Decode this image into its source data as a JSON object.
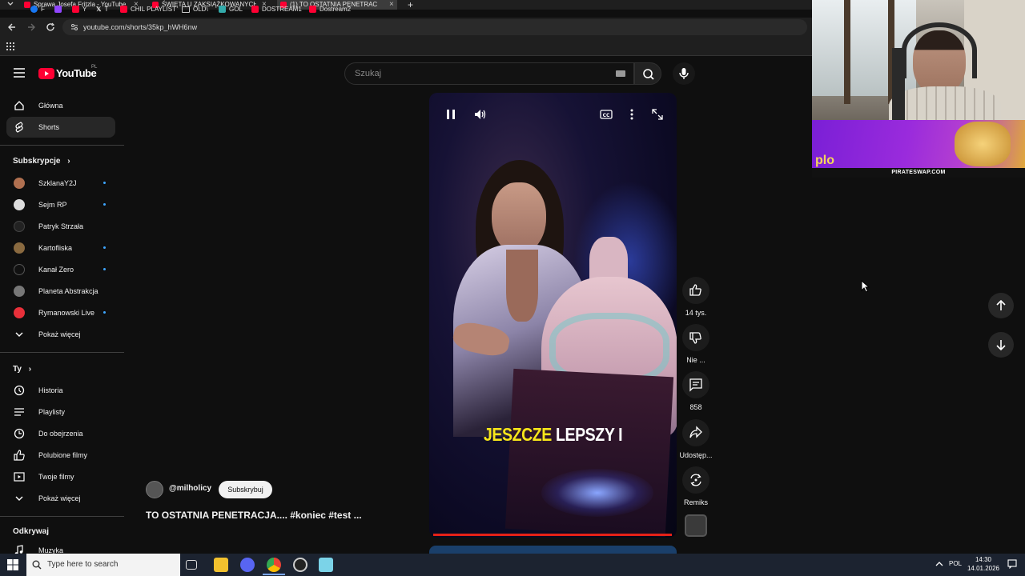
{
  "browser": {
    "tabs": [
      {
        "title": "Sprawa Josefa Fritzla - YouTube",
        "active": false
      },
      {
        "title": "ŚWIĘTA U ZAKSIĄŻKOWANYCH",
        "active": false
      },
      {
        "title": "(1) TO OSTATNIA PENETRAC",
        "active": true
      }
    ],
    "url": "youtube.com/shorts/35kp_hWH6nw",
    "bookmarks": [
      "F",
      "Y",
      "T",
      "CHIL PLAYLIST",
      "OLD\\",
      "GOL",
      "DOSTREAM1",
      "Dostream2"
    ]
  },
  "youtube": {
    "logo_text": "YouTube",
    "region": "PL",
    "search_placeholder": "Szukaj",
    "sidebar": {
      "main": [
        {
          "label": "Główna",
          "icon": "home-icon"
        },
        {
          "label": "Shorts",
          "icon": "shorts-icon",
          "active": true
        }
      ],
      "subscriptions_header": "Subskrypcje",
      "subscriptions": [
        {
          "label": "SzklanaY2J",
          "color": "#b07050",
          "new": true
        },
        {
          "label": "Sejm RP",
          "color": "#dddddd",
          "new": true
        },
        {
          "label": "Patryk Strzała",
          "color": "#222222",
          "new": false
        },
        {
          "label": "Kartofliska",
          "color": "#8a6a40",
          "new": true
        },
        {
          "label": "Kanał Zero",
          "color": "#111111",
          "new": true
        },
        {
          "label": "Planeta Abstrakcja",
          "color": "#777777",
          "new": false
        },
        {
          "label": "Rymanowski Live",
          "color": "#e8303a",
          "new": true
        }
      ],
      "show_more": "Pokaż więcej",
      "you_header": "Ty",
      "you": [
        {
          "label": "Historia",
          "icon": "history-icon"
        },
        {
          "label": "Playlisty",
          "icon": "playlist-icon"
        },
        {
          "label": "Do obejrzenia",
          "icon": "clock-icon"
        },
        {
          "label": "Polubione filmy",
          "icon": "thumb-up-icon"
        },
        {
          "label": "Twoje filmy",
          "icon": "video-icon"
        }
      ],
      "show_more_2": "Pokaż więcej",
      "explore_header": "Odkrywaj",
      "explore": [
        {
          "label": "Muzyka",
          "icon": "music-icon"
        }
      ]
    },
    "short": {
      "caption_yellow": "JESZCZE",
      "caption_white": "LEPSZY I",
      "progress": 1.0,
      "actions": [
        {
          "label": "14 tys.",
          "icon": "thumb-up-icon"
        },
        {
          "label": "Nie ...",
          "icon": "thumb-down-icon"
        },
        {
          "label": "858",
          "icon": "comment-icon"
        },
        {
          "label": "Udostęp...",
          "icon": "share-icon"
        },
        {
          "label": "Remiks",
          "icon": "remix-icon"
        }
      ],
      "channel": "@milholicy",
      "subscribe": "Subskrybuj",
      "title": "TO OSTATNIA PENETRACJA.... #koniec #test ..."
    }
  },
  "overlay": {
    "banner_text": "PIRATESWAP.COM",
    "banner_partial": "plo"
  },
  "taskbar": {
    "search_placeholder": "Type here to search",
    "language": "POL",
    "time": "14:30",
    "date": "14.01.2026"
  }
}
